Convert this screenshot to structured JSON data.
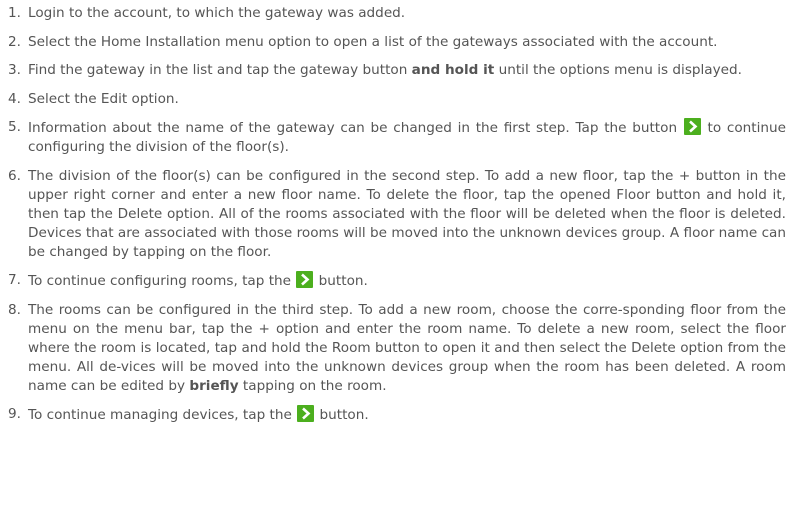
{
  "steps": [
    {
      "num": "1.",
      "text": "Login to the account, to which the gateway was added."
    },
    {
      "num": "2.",
      "text": "Select the Home Installation menu option to open a list of the gateways associated with the account."
    },
    {
      "num": "3.",
      "text_before": "Find the gateway in the list and tap the gateway button ",
      "bold": "and hold it",
      "text_after": " until the options menu is displayed."
    },
    {
      "num": "4.",
      "text": "Select the Edit option."
    },
    {
      "num": "5.",
      "text_before": "Information about the name of the gateway can be changed in the first step. Tap the button ",
      "text_after": " to continue configuring the division of the floor(s)."
    },
    {
      "num": "6.",
      "text": "The division of the floor(s) can be configured in the second step. To add a new floor, tap the + button in the upper right corner and enter a new floor name. To delete the floor, tap the opened Floor button and hold it, then tap the Delete option. All of the rooms associated with the floor will be deleted when the floor is deleted. Devices that are associated with those rooms will be moved into the unknown devices group. A floor name can be changed by tapping on the floor."
    },
    {
      "num": "7.",
      "text_before": "To continue configuring rooms, tap the ",
      "text_after": " button."
    },
    {
      "num": "8.",
      "text_before": "The rooms can be configured in the third step. To add a new room, choose the corre-sponding floor from the menu on the menu bar, tap the + option and enter the room name. To delete a new room, select the floor where the room is located, tap and hold the Room button to open it and then select the Delete option from the menu. All de-vices will be moved into the unknown devices group when the room has been deleted. A room name can be edited by ",
      "bold": "briefly",
      "text_after": " tapping on the room."
    },
    {
      "num": "9.",
      "text_before": "To continue managing devices, tap the ",
      "text_after": " button."
    }
  ],
  "icons": {
    "next_button_icon": "next-arrow-icon",
    "next_button_color": "#4caf1e"
  }
}
